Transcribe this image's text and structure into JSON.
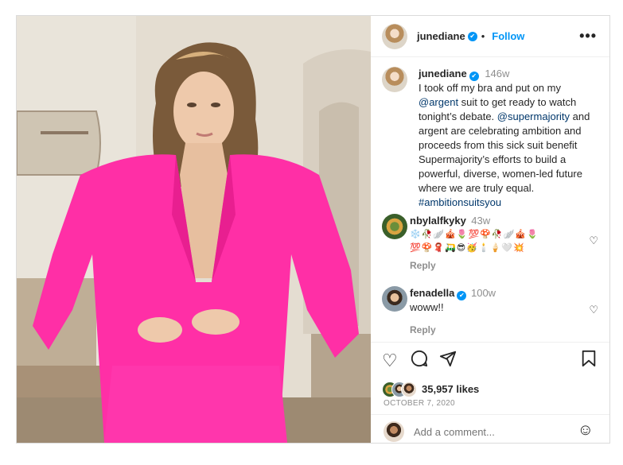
{
  "header": {
    "username": "junediane",
    "follow_label": "Follow",
    "separator": "•",
    "more_label": "•••"
  },
  "caption": {
    "username": "junediane",
    "time": "146w",
    "text_1": "I took off my bra and put on my ",
    "mention_1": "@argent",
    "text_2": " suit to get ready to watch tonight’s debate. ",
    "mention_2": "@supermajority",
    "text_3": " and argent are celebrating ambition and proceeds from this sick suit benefit Supermajority’s efforts to build a powerful, diverse, women-led future where we are truly equal. ",
    "hashtag": "#ambitionsuitsyou"
  },
  "comments": [
    {
      "username": "nbylalfkyky",
      "time": "43w",
      "text": "❄️🥀🪽🎪🌷💯🍄🥀🪽🎪🌷💯🍄🧣🛺😎🥳🕯️🍦🤍💥",
      "reply_label": "Reply"
    },
    {
      "username": "fenadella",
      "time": "100w",
      "text": "woww!!",
      "reply_label": "Reply"
    }
  ],
  "actions": {
    "likes": "35,957 likes",
    "date": "OCTOBER 7, 2020"
  },
  "add_comment": {
    "placeholder": "Add a comment..."
  },
  "colors": {
    "accent": "#0095f6",
    "suit_pink": "#ff2fa6",
    "muted": "#8e8e8e"
  }
}
